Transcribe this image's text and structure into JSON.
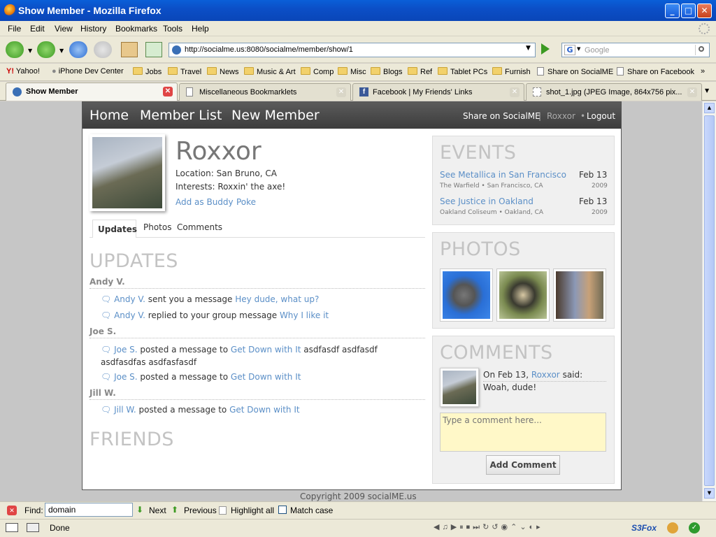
{
  "window": {
    "title": "Show Member - Mozilla Firefox"
  },
  "menu": [
    "File",
    "Edit",
    "View",
    "History",
    "Bookmarks",
    "Tools",
    "Help"
  ],
  "url": "http://socialme.us:8080/socialme/member/show/1",
  "search": {
    "engine": "G",
    "placeholder": "Google"
  },
  "bookmarks": [
    "Yahoo!",
    "iPhone Dev Center",
    "Jobs",
    "Travel",
    "News",
    "Music & Art",
    "Comp",
    "Misc",
    "Blogs",
    "Ref",
    "Tablet PCs",
    "Furnish",
    "Share on SocialME",
    "Share on Facebook"
  ],
  "tabs": [
    "Show Member",
    "Miscellaneous Bookmarklets",
    "Facebook | My Friends' Links",
    "shot_1.jpg (JPEG Image, 864x756 pix..."
  ],
  "site": {
    "nav": {
      "home": "Home",
      "member_list": "Member List",
      "new_member": "New Member",
      "share": "Share on SocialME",
      "sep1": "|",
      "user": "Roxxor",
      "sep2": "•",
      "logout": "Logout"
    },
    "profile": {
      "name": "Roxxor",
      "location": "Location: San Bruno, CA",
      "interests": "Interests: Roxxin' the axe!",
      "add_buddy": "Add as Buddy",
      "poke": "Poke"
    },
    "subtabs": [
      "Updates",
      "Photos",
      "Comments"
    ],
    "updates": {
      "heading": "UPDATES",
      "groups": [
        {
          "name": "Andy V.",
          "items": [
            {
              "who": "Andy V.",
              "text": " sent you a message ",
              "link": "Hey dude, what up?",
              "tail": ""
            },
            {
              "who": "Andy V.",
              "text": " replied to your group message ",
              "link": "Why I like it",
              "tail": ""
            }
          ]
        },
        {
          "name": "Joe S.",
          "items": [
            {
              "who": "Joe S.",
              "text": " posted a message to ",
              "link": "Get Down with It",
              "tail": " asdfasdf asdfasdf asdfasdfas asdfasfasdf"
            },
            {
              "who": "Joe S.",
              "text": " posted a message to ",
              "link": "Get Down with It",
              "tail": ""
            }
          ]
        },
        {
          "name": "Jill W.",
          "items": [
            {
              "who": "Jill W.",
              "text": " posted a message to ",
              "link": "Get Down with It",
              "tail": ""
            }
          ]
        }
      ]
    },
    "friends_heading": "FRIENDS",
    "events": {
      "heading": "EVENTS",
      "items": [
        {
          "title": "See Metallica in San Francisco",
          "venue": "The Warfield",
          "city": "San Francisco, CA",
          "date": "Feb 13",
          "year": "2009"
        },
        {
          "title": "See Justice in Oakland",
          "venue": "Oakland Coliseum",
          "city": "Oakland, CA",
          "date": "Feb 13",
          "year": "2009"
        }
      ]
    },
    "photos_heading": "PHOTOS",
    "comments": {
      "heading": "COMMENTS",
      "on": "On Feb 13,",
      "author": "Roxxor",
      "said": "said:",
      "body": "Woah, dude!",
      "placeholder": "Type a comment here...",
      "button": "Add Comment"
    },
    "copyright": "Copyright 2009 socialME.us"
  },
  "findbar": {
    "label": "Find:",
    "value": "domain",
    "next": "Next",
    "previous": "Previous",
    "highlight": "Highlight all",
    "match_case": "Match case"
  },
  "status": {
    "text": "Done",
    "s3fox": "S3Fox"
  }
}
